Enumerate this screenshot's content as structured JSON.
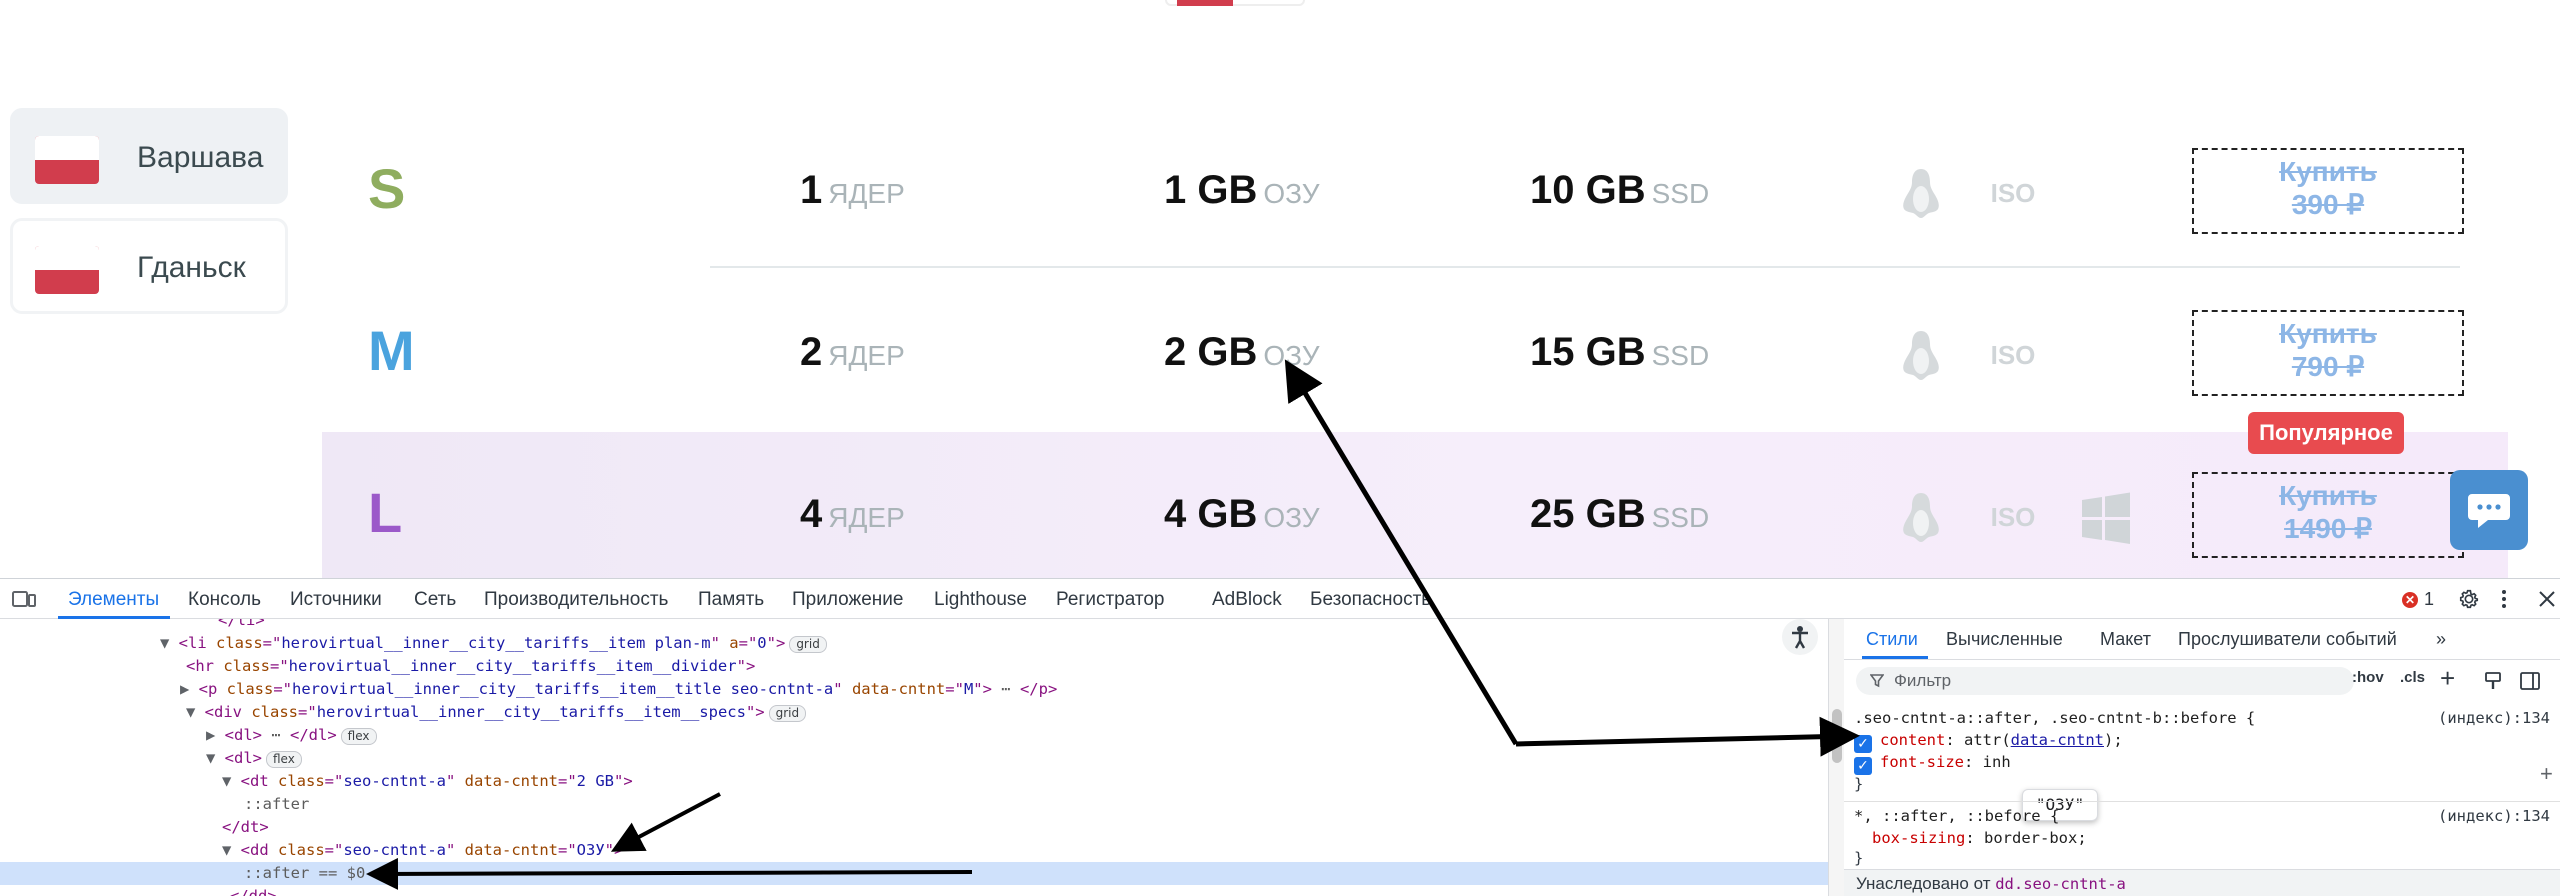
{
  "cities": [
    {
      "name": "Варшава",
      "active": true
    },
    {
      "name": "Гданьск",
      "active": false
    }
  ],
  "plans": [
    {
      "name": "S",
      "color": "#8fad5f",
      "cores": "1",
      "cores_unit": "ЯДЕР",
      "ram": "1 GB",
      "ram_unit": "ОЗУ",
      "ssd": "10 GB",
      "ssd_unit": "SSD",
      "buy_label": "Купить",
      "price": "390 ₽",
      "os_icons": [
        "linux-icon",
        "iso-icon"
      ]
    },
    {
      "name": "M",
      "color": "#4aa3de",
      "cores": "2",
      "cores_unit": "ЯДЕР",
      "ram": "2 GB",
      "ram_unit": "ОЗУ",
      "ssd": "15 GB",
      "ssd_unit": "SSD",
      "buy_label": "Купить",
      "price": "790 ₽",
      "os_icons": [
        "linux-icon",
        "iso-icon"
      ]
    },
    {
      "name": "L",
      "color": "#9b59c9",
      "cores": "4",
      "cores_unit": "ЯДЕР",
      "ram": "4 GB",
      "ram_unit": "ОЗУ",
      "ssd": "25 GB",
      "ssd_unit": "SSD",
      "buy_label": "Купить",
      "price": "1490 ₽",
      "os_icons": [
        "linux-icon",
        "iso-icon",
        "windows-icon"
      ]
    }
  ],
  "popular_badge": "Популярное",
  "devtools": {
    "tabs": [
      "Элементы",
      "Консоль",
      "Источники",
      "Сеть",
      "Производительность",
      "Память",
      "Приложение",
      "Lighthouse",
      "Регистратор",
      "AdBlock",
      "Безопасность"
    ],
    "error_count": "1",
    "styles_tabs": [
      "Стили",
      "Вычисленные",
      "Макет",
      "Прослушиватели событий"
    ],
    "filter_placeholder": "Фильтр",
    "hov": ":hov",
    "cls": ".cls",
    "dom_lines": [
      {
        "parts": [
          [
            "tag",
            "</li>"
          ]
        ]
      },
      {
        "parts": [
          [
            "tri",
            "▼"
          ],
          [
            "tag",
            "<li "
          ],
          [
            "an",
            "class"
          ],
          [
            "tag",
            "=\""
          ],
          [
            "av",
            "herovirtual__inner__city__tariffs__item plan-m"
          ],
          [
            "tag",
            "\" "
          ],
          [
            "an",
            "a"
          ],
          [
            "tag",
            "=\""
          ],
          [
            "av",
            "0"
          ],
          [
            "tag",
            "\">"
          ]
        ],
        "pill": "grid"
      },
      {
        "parts": [
          [
            "tag",
            "<hr "
          ],
          [
            "an",
            "class"
          ],
          [
            "tag",
            "=\""
          ],
          [
            "av",
            "herovirtual__inner__city__tariffs__item__divider"
          ],
          [
            "tag",
            "\">"
          ]
        ]
      },
      {
        "parts": [
          [
            "tri",
            "▶"
          ],
          [
            "tag",
            "<p "
          ],
          [
            "an",
            "class"
          ],
          [
            "tag",
            "=\""
          ],
          [
            "av",
            "herovirtual__inner__city__tariffs__item__title seo-cntnt-a"
          ],
          [
            "tag",
            "\" "
          ],
          [
            "an",
            "data-cntnt"
          ],
          [
            "tag",
            "=\""
          ],
          [
            "av",
            "M"
          ],
          [
            "tag",
            "\">"
          ],
          [
            "pe",
            " ⋯ "
          ],
          [
            "tag",
            "</p>"
          ]
        ]
      },
      {
        "parts": [
          [
            "tri",
            "▼"
          ],
          [
            "tag",
            "<div "
          ],
          [
            "an",
            "class"
          ],
          [
            "tag",
            "=\""
          ],
          [
            "av",
            "herovirtual__inner__city__tariffs__item__specs"
          ],
          [
            "tag",
            "\">"
          ]
        ],
        "pill": "grid"
      },
      {
        "parts": [
          [
            "tri",
            "▶"
          ],
          [
            "tag",
            "<dl>"
          ],
          [
            "pe",
            " ⋯ "
          ],
          [
            "tag",
            "</dl>"
          ]
        ],
        "pill": "flex"
      },
      {
        "parts": [
          [
            "tri",
            "▼"
          ],
          [
            "tag",
            "<dl>"
          ]
        ],
        "pill": "flex"
      },
      {
        "parts": [
          [
            "tri",
            "▼"
          ],
          [
            "tag",
            "<dt "
          ],
          [
            "an",
            "class"
          ],
          [
            "tag",
            "=\""
          ],
          [
            "av",
            "seo-cntnt-a"
          ],
          [
            "tag",
            "\" "
          ],
          [
            "an",
            "data-cntnt"
          ],
          [
            "tag",
            "=\""
          ],
          [
            "av",
            "2 GB"
          ],
          [
            "tag",
            "\">"
          ]
        ]
      },
      {
        "parts": [
          [
            "pe",
            "::after"
          ]
        ]
      },
      {
        "parts": [
          [
            "tag",
            "</dt>"
          ]
        ]
      },
      {
        "parts": [
          [
            "tri",
            "▼"
          ],
          [
            "tag",
            "<dd "
          ],
          [
            "an",
            "class"
          ],
          [
            "tag",
            "=\""
          ],
          [
            "av",
            "seo-cntnt-a"
          ],
          [
            "tag",
            "\" "
          ],
          [
            "an",
            "data-cntnt"
          ],
          [
            "tag",
            "=\""
          ],
          [
            "av",
            "ОЗУ"
          ],
          [
            "tag",
            "\">"
          ]
        ]
      },
      {
        "parts": [
          [
            "pe",
            "::after == $0"
          ]
        ],
        "selected": true
      },
      {
        "parts": [
          [
            "tag",
            "</dd>"
          ]
        ]
      }
    ],
    "rule1": {
      "selector": ".seo-cntnt-a::after, .seo-cntnt-b::before {",
      "source": "(индекс):134",
      "prop1_name": "content",
      "prop1_value_pre": "attr(",
      "prop1_link": "data-cntnt",
      "prop1_value_post": ");",
      "prop2_name": "font-size",
      "prop2_value": "inh",
      "close": "}"
    },
    "tooltip": "\"ОЗУ\"",
    "rule2": {
      "selector": "*, ::after, ::before {",
      "source": "(индекс):134",
      "prop_name": "box-sizing",
      "prop_value": "border-box;",
      "close": "}"
    },
    "inherited_label": "Унаследовано от",
    "inherited_from": "dd.seo-cntnt-a"
  }
}
